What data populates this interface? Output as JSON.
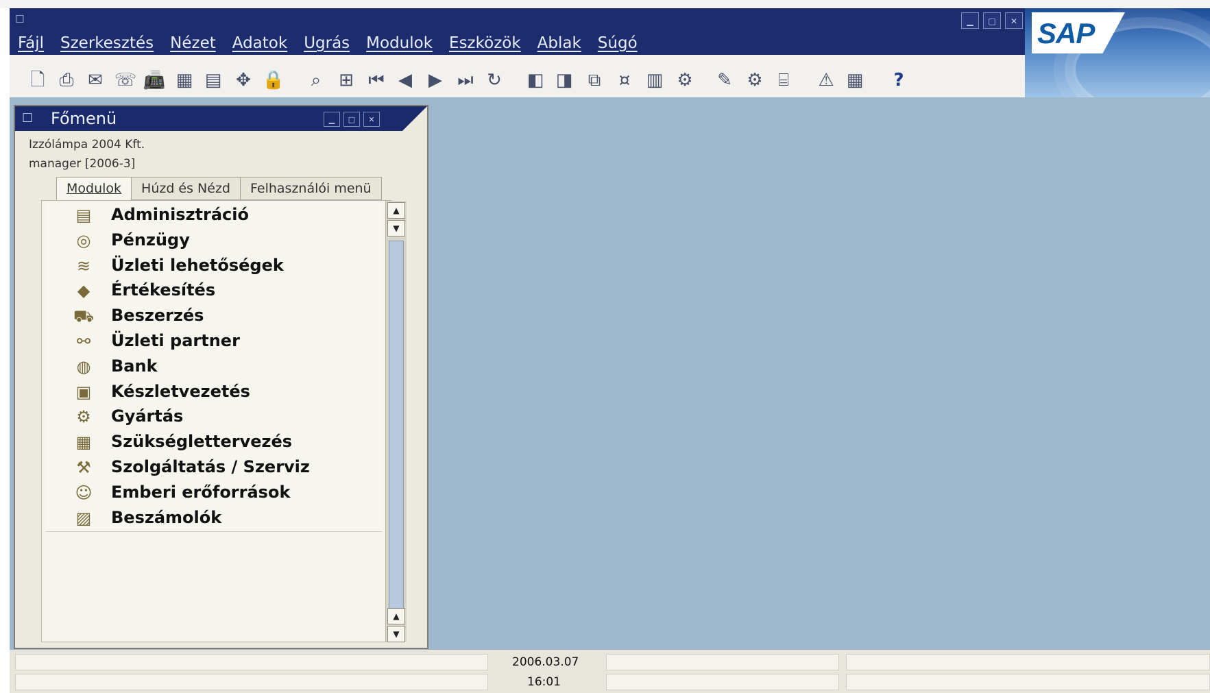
{
  "window": {
    "app_icon": "folder-arrow-icon",
    "controls": {
      "minimize": "minimize-icon",
      "maximize": "maximize-icon",
      "close": "close-icon"
    }
  },
  "brand": {
    "logo_text": "SAP"
  },
  "menubar": {
    "items": [
      "Fájl",
      "Szerkesztés",
      "Nézet",
      "Adatok",
      "Ugrás",
      "Modulok",
      "Eszközök",
      "Ablak",
      "Súgó"
    ]
  },
  "toolbar": {
    "icons": [
      "print-preview-icon",
      "print-icon",
      "email-icon",
      "sms-icon",
      "fax-icon",
      "excel-icon",
      "word-icon",
      "move-icon",
      "lock-icon",
      "find-icon",
      "add-icon",
      "first-record-icon",
      "previous-record-icon",
      "next-record-icon",
      "last-record-icon",
      "refresh-icon",
      "base-document-icon",
      "target-document-icon",
      "copy-icon",
      "money-icon",
      "report-icon",
      "settings-icon",
      "pencil-icon",
      "gear-icon",
      "query-icon",
      "warning-icon",
      "calendar-icon",
      "help-icon"
    ]
  },
  "main_menu": {
    "title": "Főmenü",
    "company": "Izzólámpa 2004 Kft.",
    "user": "manager  [2006-3]",
    "tabs": [
      "Modulok",
      "Húzd és Nézd",
      "Felhasználói menü"
    ],
    "active_tab": "Modulok",
    "modules": [
      {
        "label": "Adminisztráció",
        "icon": "administration-icon"
      },
      {
        "label": "Pénzügy",
        "icon": "finance-icon"
      },
      {
        "label": "Üzleti lehetőségek",
        "icon": "opportunities-icon"
      },
      {
        "label": "Értékesítés",
        "icon": "sales-icon"
      },
      {
        "label": "Beszerzés",
        "icon": "purchasing-icon"
      },
      {
        "label": "Üzleti partner",
        "icon": "business-partner-icon"
      },
      {
        "label": "Bank",
        "icon": "bank-icon"
      },
      {
        "label": "Készletvezetés",
        "icon": "inventory-icon"
      },
      {
        "label": "Gyártás",
        "icon": "production-icon"
      },
      {
        "label": "Szükséglettervezés",
        "icon": "mrp-icon"
      },
      {
        "label": "Szolgáltatás / Szerviz",
        "icon": "service-icon"
      },
      {
        "label": "Emberi erőforrások",
        "icon": "human-resources-icon"
      },
      {
        "label": "Beszámolók",
        "icon": "reports-icon"
      }
    ]
  },
  "status": {
    "date": "2006.03.07",
    "time": "16:01"
  },
  "colors": {
    "titlebar": "#1c2c6c",
    "workspace": "#9db8cc",
    "panel": "#ece9de"
  }
}
